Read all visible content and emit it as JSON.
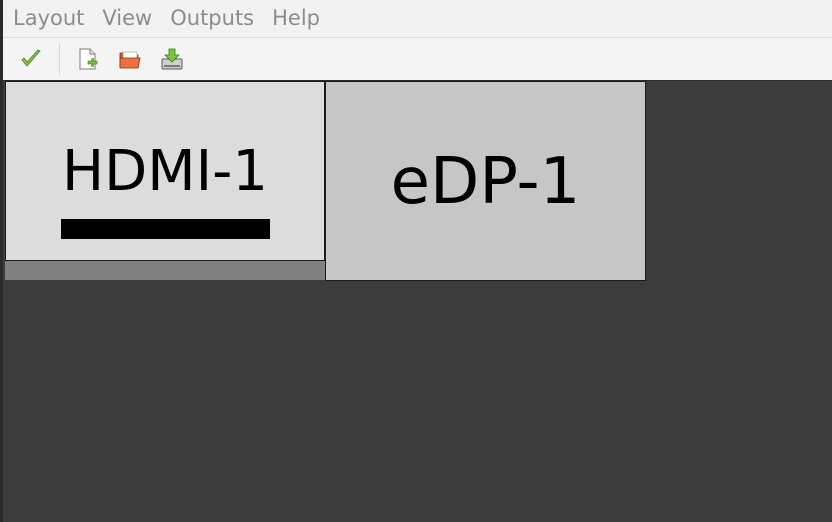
{
  "menubar": {
    "items": [
      {
        "label": "Layout"
      },
      {
        "label": "View"
      },
      {
        "label": "Outputs"
      },
      {
        "label": "Help"
      }
    ]
  },
  "toolbar": {
    "buttons": [
      {
        "icon": "apply-check-icon"
      },
      {
        "icon": "new-layout-icon"
      },
      {
        "icon": "open-layout-icon"
      },
      {
        "icon": "save-layout-icon"
      }
    ]
  },
  "outputs": [
    {
      "name": "HDMI-1",
      "primary": true,
      "color": "#dcdcdc"
    },
    {
      "name": "eDP-1",
      "primary": false,
      "color": "#c6c6c6"
    }
  ],
  "colors": {
    "menu_text": "#8c8c8c",
    "canvas_bg": "#3c3c3c",
    "accent_check": "#8bc34a"
  }
}
